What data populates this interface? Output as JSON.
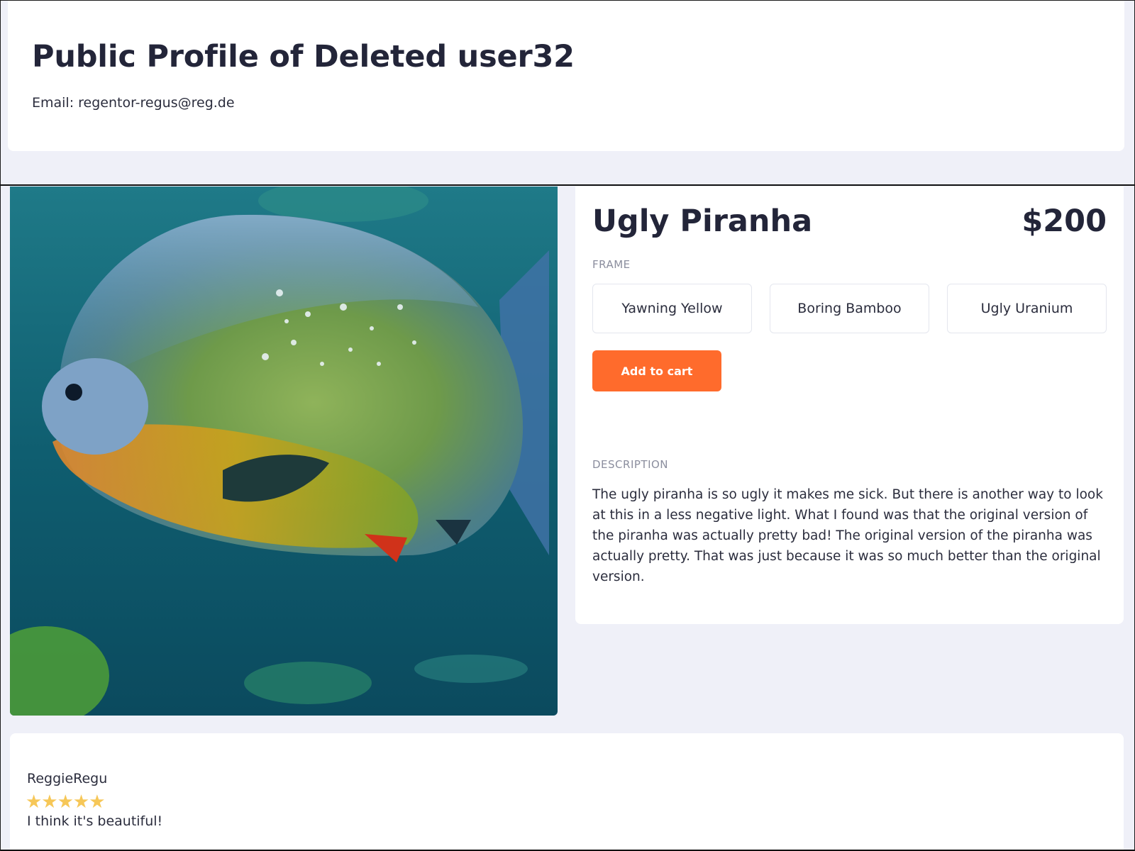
{
  "profile": {
    "title": "Public Profile of Deleted user32",
    "email_label": "Email:",
    "email_value": "regentor-regus@reg.de"
  },
  "product": {
    "name": "Ugly Piranha",
    "price": "$200",
    "frame_label": "FRAME",
    "frame_options": [
      "Yawning Yellow",
      "Boring Bamboo",
      "Ugly Uranium"
    ],
    "add_to_cart_label": "Add to cart",
    "description_label": "DESCRIPTION",
    "description": "The ugly piranha is so ugly it makes me sick. But there is another way to look at this in a less negative light. What I found was that the original version of the piranha was actually pretty bad! The original version of the piranha was actually pretty. That was just because it was so much better than the original version.",
    "image_icon": "piranha-photo"
  },
  "review": {
    "author": "ReggieRegu",
    "rating": 5,
    "rating_max": 5,
    "stars": "★★★★★",
    "text": "I think it's beautiful!"
  },
  "colors": {
    "background": "#eff0f8",
    "accent": "#ff6b2c",
    "star": "#f6c758",
    "text": "#232539"
  }
}
